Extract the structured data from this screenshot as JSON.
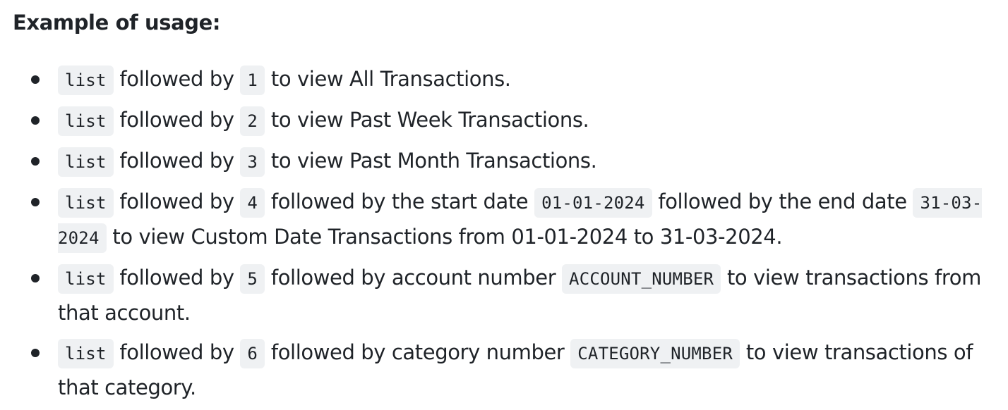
{
  "heading": "Example of usage:",
  "items": [
    {
      "cmd": "list",
      "mid": " followed by ",
      "num": "1",
      "rest": " to view All Transactions."
    },
    {
      "cmd": "list",
      "mid": " followed by ",
      "num": "2",
      "rest": " to view Past Week Transactions."
    },
    {
      "cmd": "list",
      "mid": " followed by ",
      "num": "3",
      "rest": " to view Past Month Transactions."
    },
    {
      "cmd": "list",
      "mid": " followed by ",
      "num": "4",
      "text_a": " followed by the start date ",
      "code_a": "01-01-2024",
      "text_b": " followed by the end date ",
      "code_b": "31-03-2024",
      "text_c": " to view Custom Date Transactions from 01-01-2024 to 31-03-2024."
    },
    {
      "cmd": "list",
      "mid": " followed by ",
      "num": "5",
      "text_a": " followed by account number ",
      "code_a": "ACCOUNT_NUMBER",
      "text_b": " to view transactions from that account."
    },
    {
      "cmd": "list",
      "mid": " followed by ",
      "num": "6",
      "text_a": " followed by category number ",
      "code_a": "CATEGORY_NUMBER",
      "text_b": " to view transactions of that category."
    }
  ]
}
